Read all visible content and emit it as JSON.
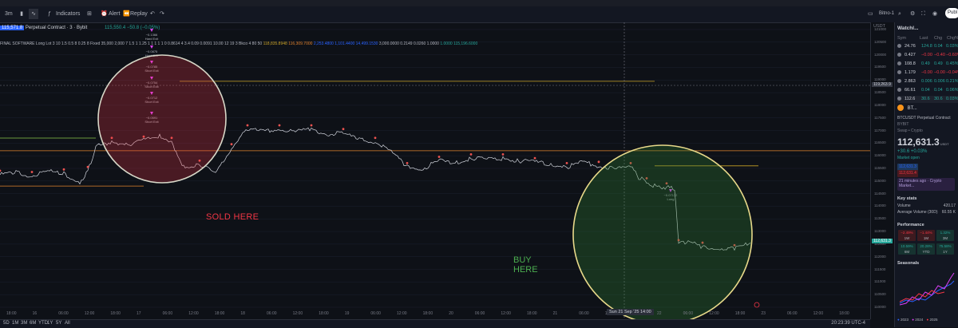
{
  "toolbar": {
    "timeframe": "3m",
    "indicators": "Indicators",
    "alert": "Alert",
    "replay": "Replay",
    "publish": "Publ",
    "layout_name": "Bitno-1"
  },
  "legend": {
    "symbol": "Perpetual Contract · 3 · Bybit",
    "last_value": "115,550.4 −50.8 (−0.05%)",
    "price_box": "115,571.8",
    "indicator_line": "FINAL SOFTWARE Long Lot 3 10 1.5 0.5 8 0.25 8 Fixed 35,000 2,000 7 1.5 1 1.25 1 1 1 1 1 0 0.8614 4 3.4 0.09 0.0091 10.00 12 19 3 Bkco 4 80 50",
    "indicator_values": [
      "118,835.8948",
      "116,309.7000",
      "2,253.4800",
      "1,101.4400",
      "14,499.1530",
      "3,000.0000",
      "0.2149",
      "0.0260",
      "1.0000",
      "1.0000",
      "115,196.6000"
    ]
  },
  "annotations": {
    "sold_here": "SOLD HERE",
    "buy_here_line1": "BUY",
    "buy_here_line2": "HERE",
    "signals": [
      {
        "value": "−0.1366",
        "label": "Hard Exit"
      },
      {
        "value": "−0.0875",
        "label": "Hard Exit"
      },
      {
        "value": "−0.0785",
        "label": "Short Exit"
      },
      {
        "value": "−0.0754",
        "label": "Short Exit"
      },
      {
        "value": "−0.0712",
        "label": "Short Exit"
      },
      {
        "value": "−0.0591",
        "label": "Short Exit"
      },
      {
        "value": "−0.07172",
        "label": "Long"
      }
    ]
  },
  "yaxis": {
    "currency": "USDT",
    "current_price": "115,550.4",
    "marker_price": "119,263.9"
  },
  "xaxis": {
    "crosshair_label": "Sun 21 Sep '25 14:00",
    "timezone": "20:23:39 UTC-4",
    "ranges": [
      "5D",
      "1M",
      "3M",
      "6M",
      "YTD",
      "1Y",
      "5Y",
      "All"
    ]
  },
  "sidebar": {
    "title": "Watchl...",
    "col_headers": [
      "Sym",
      "Last",
      "Chg",
      "Chg%"
    ],
    "watchlist": [
      {
        "sym": "24.76",
        "last": "124.8",
        "chg": "0.04",
        "chgp": "0.03%",
        "color": "#26a69a"
      },
      {
        "sym": "0.427",
        "last": "−0.00",
        "chg": "−0.40",
        "chgp": "−0.60%",
        "color": "#f23645"
      },
      {
        "sym": "108.8",
        "last": "0.49",
        "chg": "0.49",
        "chgp": "0.45%",
        "color": "#26a69a"
      },
      {
        "sym": "1.179",
        "last": "−0.00",
        "chg": "−0.00",
        "chgp": "−0.04%",
        "color": "#f23645"
      },
      {
        "sym": "2.863",
        "last": "0.006",
        "chg": "0.006",
        "chgp": "0.21%",
        "color": "#26a69a"
      },
      {
        "sym": "66.61",
        "last": "0.04",
        "chg": "0.04",
        "chgp": "0.06%",
        "color": "#26a69a"
      },
      {
        "sym": "112.6",
        "last": "30.6",
        "chg": "30.6",
        "chgp": "0.03%",
        "color": "#26a69a"
      }
    ],
    "detail_symbol": "BTCUSDT Perpetual Contract",
    "detail_exchange": "BYBIT",
    "detail_type": "Swap • Crypto",
    "detail_price": "112,631.3",
    "detail_currency": "USDT",
    "detail_change": "+30.6 +0.03%",
    "market_status": "Market open",
    "bid": "112,631.3",
    "ask": "112,631.4",
    "news": "21 minutes ago · Crypto Market...",
    "key_stats": "Key stats",
    "volume_label": "Volume",
    "volume_value": "420.17",
    "avg_volume_label": "Average Volume (30D)",
    "avg_volume_value": "60.55 K",
    "performance": "Performance",
    "perf": [
      {
        "v": "−2.49%",
        "p": "1W",
        "c": "#f23645"
      },
      {
        "v": "−1.44%",
        "p": "1M",
        "c": "#f23645"
      },
      {
        "v": "1.32%",
        "p": "3M",
        "c": "#26a69a"
      },
      {
        "v": "10.59%",
        "p": "6M",
        "c": "#26a69a"
      },
      {
        "v": "20.28%",
        "p": "YTD",
        "c": "#26a69a"
      },
      {
        "v": "75.58%",
        "p": "1Y",
        "c": "#26a69a"
      }
    ],
    "seasonals": "Seasonals",
    "seasonals_legend": [
      "2023",
      "2024",
      "2025"
    ]
  },
  "chart_data": {
    "type": "line",
    "title": "BTCUSDT Perpetual Contract · 3 · Bybit",
    "ylim": [
      110000,
      121000
    ],
    "yticks": [
      121000,
      120500,
      120000,
      119500,
      119000,
      118500,
      118000,
      117500,
      117000,
      116500,
      116000,
      115500,
      115000,
      114500,
      114000,
      113500,
      113000,
      112500,
      112000,
      111500,
      111000,
      110500,
      110000
    ],
    "xticks": [
      "18:00",
      "16",
      "06:00",
      "12:00",
      "18:00",
      "17",
      "06:00",
      "12:00",
      "18:00",
      "18",
      "06:00",
      "12:00",
      "18:00",
      "19",
      "06:00",
      "12:00",
      "18:00",
      "20",
      "06:00",
      "12:00",
      "18:00",
      "21",
      "06:00",
      "12:00",
      "18:00",
      "22",
      "06:00",
      "12:00",
      "18:00",
      "23",
      "06:00",
      "12:00",
      "18:00"
    ],
    "series": [
      {
        "color": "#d1d4dc",
        "x": [
          0,
          20,
          40,
          60,
          80,
          100,
          110,
          120,
          140,
          160,
          180,
          200,
          215,
          230,
          250,
          270,
          290,
          300,
          310,
          330,
          350,
          370,
          390,
          410,
          430,
          450,
          470,
          490,
          510,
          530,
          550,
          570,
          590,
          610,
          630,
          650,
          670,
          690,
          710,
          730,
          750,
          770,
          790,
          800,
          810,
          820,
          835,
          845,
          850,
          860,
          880,
          900,
          920,
          940
        ],
        "y": [
          115250,
          115350,
          115200,
          115400,
          115300,
          114950,
          115400,
          116350,
          116550,
          116450,
          116600,
          116800,
          116550,
          115550,
          115650,
          115300,
          116300,
          116700,
          117050,
          116950,
          117050,
          116950,
          117050,
          116850,
          116900,
          116650,
          116550,
          116150,
          115550,
          115500,
          115800,
          115700,
          115900,
          115850,
          115900,
          115800,
          115750,
          115650,
          115550,
          115750,
          115600,
          115500,
          115550,
          115150,
          114950,
          114800,
          114750,
          114700,
          112500,
          112600,
          112400,
          112350,
          112300,
          112550
        ]
      }
    ],
    "levels": [
      {
        "y": 118950,
        "color": "#c9a227"
      },
      {
        "y": 116200,
        "color": "#e0822d"
      },
      {
        "y": 114800,
        "color": "#e0822d"
      },
      {
        "y": 115600,
        "color": "#c9a227"
      },
      {
        "y": 116700,
        "color": "#8bc34a"
      }
    ]
  }
}
